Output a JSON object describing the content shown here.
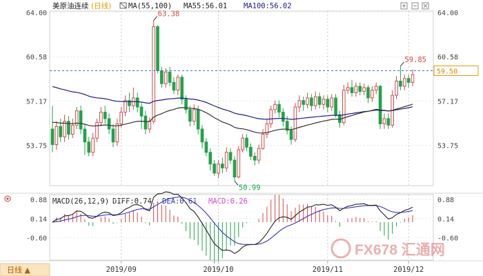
{
  "chart_data": [
    {
      "type": "candlestick",
      "panel": "main",
      "header": {
        "symbol": "美原油连续",
        "period": "(日线)",
        "ma_label": "MA(55,100)",
        "ma55_text": "MA55:56.01",
        "ma100_text": "MA100:56.02"
      },
      "y_ticks": [
        "64.00",
        "60.58",
        "57.17",
        "53.75"
      ],
      "ylim": [
        50.58,
        64.0
      ],
      "price_tag": "59.50",
      "price_line": 59.5,
      "annotations": {
        "high": "63.38",
        "low": "50.99",
        "recent_high": "59.85"
      },
      "ma55_color": "#333333",
      "ma100_color": "#1c1c8c",
      "up_color": "#d24a4a",
      "down_color": "#22a34a",
      "candles": [
        [
          55.0,
          53.8,
          56.8,
          53.2
        ],
        [
          53.8,
          55.2,
          55.6,
          53.4
        ],
        [
          55.2,
          54.4,
          55.8,
          54.0
        ],
        [
          54.4,
          55.6,
          56.1,
          54.0
        ],
        [
          55.6,
          54.6,
          56.0,
          54.2
        ],
        [
          54.6,
          55.3,
          55.8,
          54.3
        ],
        [
          55.3,
          56.4,
          56.7,
          55.0
        ],
        [
          56.4,
          55.0,
          56.8,
          54.6
        ],
        [
          55.0,
          54.0,
          55.4,
          53.0
        ],
        [
          54.0,
          53.2,
          54.4,
          52.9
        ],
        [
          53.2,
          54.3,
          54.7,
          52.9
        ],
        [
          54.3,
          55.5,
          55.8,
          54.0
        ],
        [
          55.5,
          56.3,
          56.7,
          55.2
        ],
        [
          56.3,
          55.8,
          56.8,
          55.4
        ],
        [
          55.8,
          55.0,
          56.2,
          54.6
        ],
        [
          55.0,
          54.0,
          55.4,
          53.6
        ],
        [
          54.0,
          55.4,
          55.8,
          53.7
        ],
        [
          55.4,
          56.3,
          56.7,
          55.1
        ],
        [
          56.3,
          57.2,
          57.6,
          56.0
        ],
        [
          57.2,
          56.8,
          57.8,
          56.3
        ],
        [
          56.8,
          57.4,
          58.2,
          56.5
        ],
        [
          57.4,
          56.7,
          57.8,
          56.3
        ],
        [
          56.7,
          56.0,
          57.0,
          55.0
        ],
        [
          56.0,
          55.0,
          56.4,
          54.6
        ],
        [
          55.0,
          55.6,
          55.9,
          54.7
        ],
        [
          55.6,
          62.9,
          63.38,
          55.4
        ],
        [
          62.9,
          59.5,
          63.0,
          59.3
        ],
        [
          59.5,
          58.5,
          59.8,
          58.2
        ],
        [
          58.5,
          59.4,
          59.7,
          58.2
        ],
        [
          59.4,
          58.6,
          59.8,
          58.3
        ],
        [
          58.6,
          58.0,
          59.0,
          57.7
        ],
        [
          58.0,
          59.0,
          59.2,
          57.6
        ],
        [
          59.0,
          57.3,
          59.2,
          56.9
        ],
        [
          57.3,
          56.5,
          57.6,
          56.2
        ],
        [
          56.5,
          55.6,
          56.8,
          55.2
        ],
        [
          55.6,
          56.5,
          56.9,
          55.3
        ],
        [
          56.5,
          55.0,
          56.8,
          54.6
        ],
        [
          55.0,
          54.0,
          55.3,
          53.5
        ],
        [
          54.0,
          53.2,
          54.3,
          52.9
        ],
        [
          53.2,
          52.3,
          53.5,
          51.8
        ],
        [
          52.3,
          51.6,
          52.6,
          51.4
        ],
        [
          51.6,
          52.3,
          52.6,
          51.2
        ],
        [
          52.3,
          52.0,
          52.8,
          51.6
        ],
        [
          52.0,
          53.2,
          53.6,
          51.7
        ],
        [
          53.2,
          52.6,
          53.5,
          52.3
        ],
        [
          52.6,
          51.3,
          52.9,
          50.99
        ],
        [
          51.3,
          53.4,
          53.7,
          51.2
        ],
        [
          53.4,
          54.3,
          54.6,
          53.2
        ],
        [
          54.3,
          53.6,
          54.6,
          53.3
        ],
        [
          53.6,
          52.9,
          53.9,
          52.6
        ],
        [
          52.9,
          52.6,
          53.2,
          52.2
        ],
        [
          52.6,
          53.5,
          53.8,
          52.3
        ],
        [
          53.5,
          54.6,
          55.0,
          53.4
        ],
        [
          54.6,
          55.4,
          55.8,
          54.3
        ],
        [
          55.4,
          56.5,
          56.8,
          55.1
        ],
        [
          56.5,
          56.9,
          57.2,
          56.2
        ],
        [
          56.9,
          56.3,
          57.2,
          55.9
        ],
        [
          56.3,
          55.6,
          56.6,
          55.2
        ],
        [
          55.6,
          54.9,
          56.0,
          54.6
        ],
        [
          54.9,
          54.2,
          55.2,
          53.8
        ],
        [
          54.2,
          56.7,
          57.0,
          54.0
        ],
        [
          56.7,
          57.2,
          57.6,
          56.3
        ],
        [
          57.2,
          56.9,
          57.5,
          56.4
        ],
        [
          56.9,
          57.4,
          57.8,
          56.6
        ],
        [
          57.4,
          56.8,
          57.7,
          56.4
        ],
        [
          56.8,
          57.5,
          57.9,
          56.5
        ],
        [
          57.5,
          56.9,
          57.8,
          56.6
        ],
        [
          56.9,
          57.3,
          57.6,
          56.5
        ],
        [
          57.3,
          56.7,
          57.6,
          56.3
        ],
        [
          56.7,
          57.4,
          57.7,
          56.4
        ],
        [
          57.4,
          56.1,
          57.7,
          55.9
        ],
        [
          56.1,
          55.5,
          56.4,
          55.1
        ],
        [
          55.5,
          58.0,
          58.4,
          55.3
        ],
        [
          58.0,
          58.2,
          58.6,
          57.7
        ],
        [
          58.2,
          57.8,
          58.8,
          57.5
        ],
        [
          57.8,
          58.3,
          58.6,
          57.5
        ],
        [
          58.3,
          57.9,
          58.6,
          57.6
        ],
        [
          57.9,
          58.2,
          58.5,
          57.6
        ],
        [
          58.2,
          57.4,
          58.4,
          57.0
        ],
        [
          57.4,
          58.0,
          58.3,
          57.1
        ],
        [
          58.0,
          58.3,
          58.6,
          57.7
        ],
        [
          58.3,
          55.4,
          58.4,
          55.0
        ],
        [
          55.4,
          55.8,
          56.2,
          55.0
        ],
        [
          55.8,
          55.3,
          56.2,
          55.0
        ],
        [
          55.3,
          57.6,
          58.0,
          55.1
        ],
        [
          57.6,
          58.7,
          59.1,
          57.3
        ],
        [
          58.7,
          58.3,
          59.85,
          58.0
        ],
        [
          58.3,
          58.9,
          59.2,
          58.0
        ],
        [
          58.9,
          58.6,
          59.2,
          58.2
        ],
        [
          58.6,
          59.2,
          59.6,
          58.3
        ]
      ]
    },
    {
      "type": "macd",
      "panel": "indicator",
      "header": {
        "name": "MACD(26,12,9)",
        "diff_text": "DIFF:0.74",
        "dea_text": "DEA:0.61",
        "macd_text": "MACD:0.26"
      },
      "y_ticks": [
        "0.88",
        "0.14",
        "-0.60"
      ],
      "ylim": [
        -1.45,
        1.02
      ],
      "diff_color": "#222222",
      "dea_color": "#3434b8",
      "hist_up_color": "#d24a4a",
      "hist_down_color": "#22a34a",
      "x_labels": [
        "2019/09",
        "2019/10",
        "2019/11",
        "2019/12"
      ],
      "x_label_index": [
        17,
        41,
        68,
        88
      ]
    }
  ],
  "footer": {
    "period_button": "日线 ▲"
  },
  "watermark": "FX678 汇通网"
}
